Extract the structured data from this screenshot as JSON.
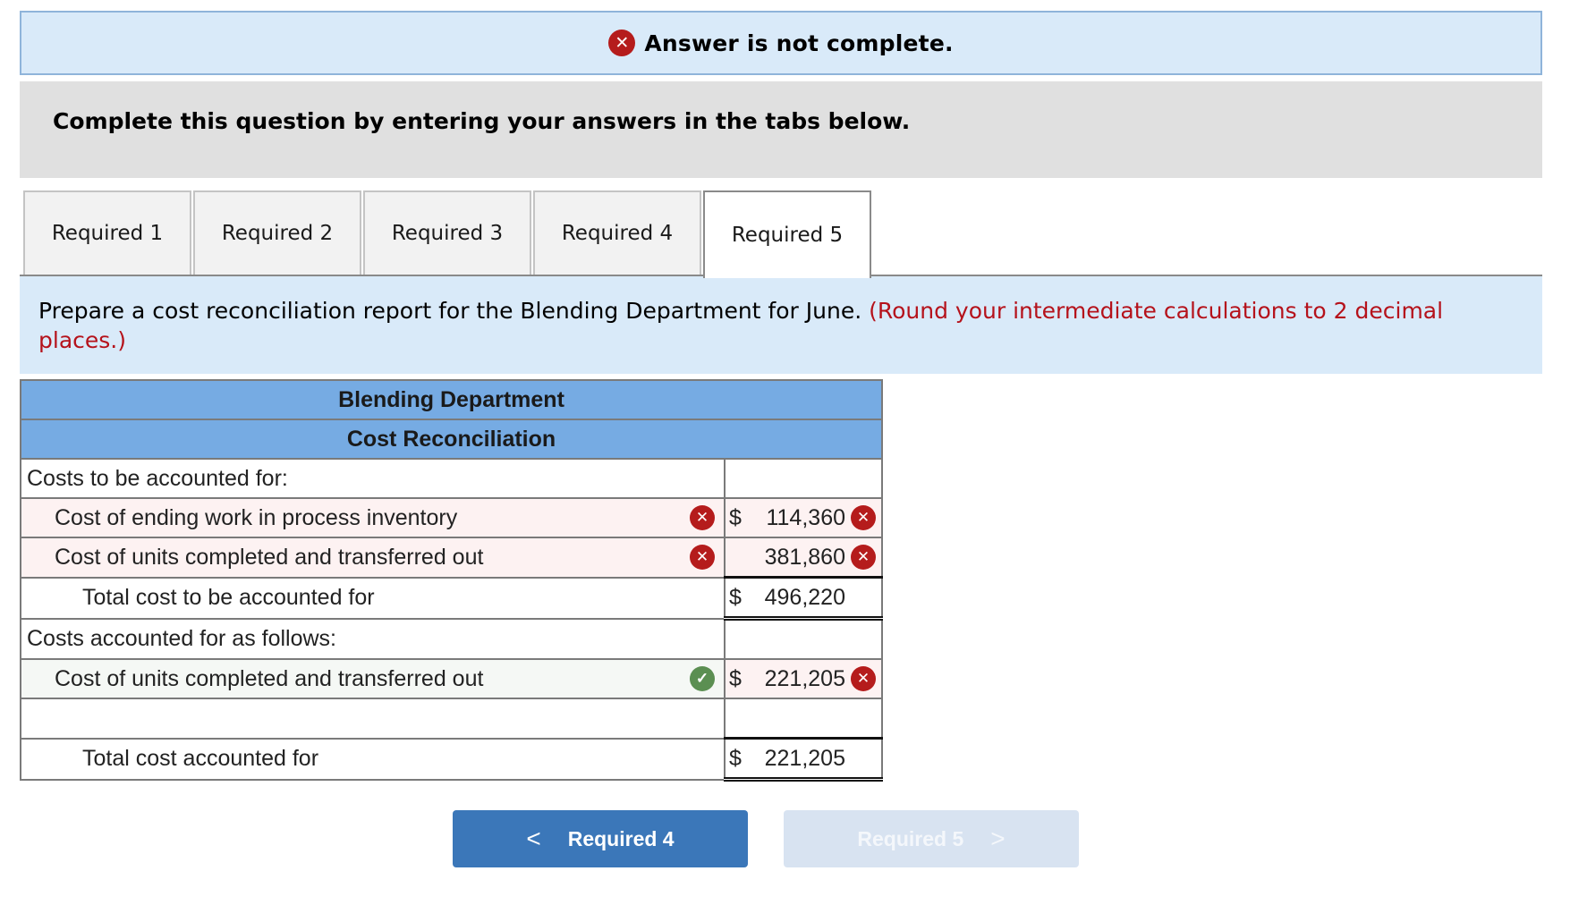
{
  "status_banner": {
    "icon": "x-circle-icon",
    "text": "Answer is not complete."
  },
  "instructions": "Complete this question by entering your answers in the tabs below.",
  "tabs": [
    {
      "label": "Required 1",
      "active": false
    },
    {
      "label": "Required 2",
      "active": false
    },
    {
      "label": "Required 3",
      "active": false
    },
    {
      "label": "Required 4",
      "active": false
    },
    {
      "label": "Required 5",
      "active": true
    }
  ],
  "prompt": {
    "text": "Prepare a cost reconciliation report for the Blending Department for June.",
    "note": "(Round your intermediate calculations to 2 decimal places.)"
  },
  "table": {
    "title": "Blending Department",
    "subtitle": "Cost Reconciliation",
    "rows": [
      {
        "label": "Costs to be accounted for:",
        "indent": 0,
        "currency": "",
        "value": "",
        "label_status": "",
        "value_status": ""
      },
      {
        "label": "Cost of ending work in process inventory",
        "indent": 1,
        "currency": "$",
        "value": "114,360",
        "label_status": "incorrect",
        "value_status": "incorrect"
      },
      {
        "label": "Cost of units completed and transferred out",
        "indent": 1,
        "currency": "",
        "value": "381,860",
        "label_status": "incorrect",
        "value_status": "incorrect"
      },
      {
        "label": "Total cost to be accounted for",
        "indent": 2,
        "currency": "$",
        "value": "496,220",
        "label_status": "",
        "value_status": ""
      },
      {
        "label": "Costs accounted for as follows:",
        "indent": 0,
        "currency": "",
        "value": "",
        "label_status": "",
        "value_status": ""
      },
      {
        "label": "Cost of units completed and transferred out",
        "indent": 1,
        "currency": "$",
        "value": "221,205",
        "label_status": "correct",
        "value_status": "incorrect"
      },
      {
        "label": "",
        "indent": 1,
        "currency": "",
        "value": "",
        "label_status": "",
        "value_status": ""
      },
      {
        "label": "Total cost accounted for",
        "indent": 2,
        "currency": "$",
        "value": "221,205",
        "label_status": "",
        "value_status": ""
      }
    ]
  },
  "nav": {
    "prev_label": "Required 4",
    "next_label": "Required 5",
    "prev_icon": "chevron-left-icon",
    "next_icon": "chevron-right-icon"
  },
  "colors": {
    "incorrect": "#b51c1c",
    "correct": "#5b8f52",
    "header_blue": "#76abe3",
    "button_blue": "#3b77b9"
  }
}
